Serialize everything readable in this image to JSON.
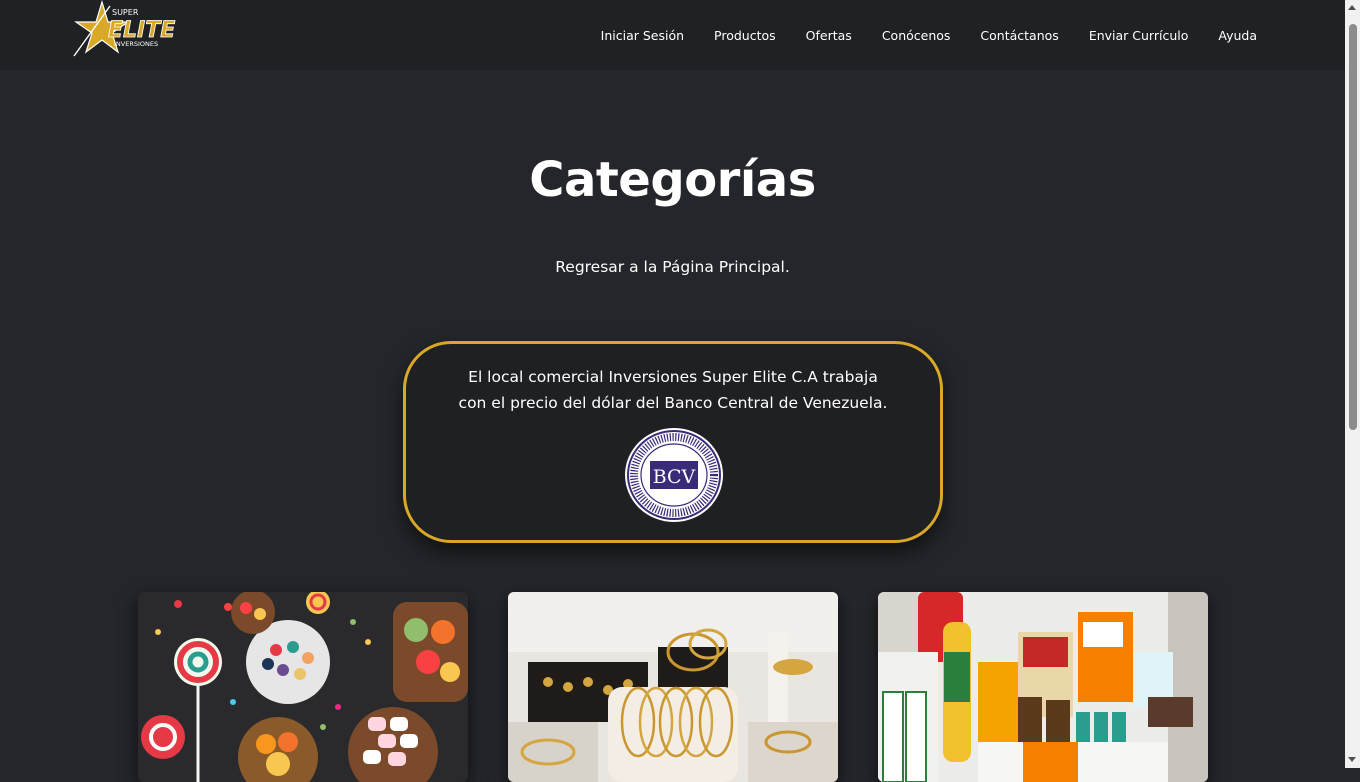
{
  "header": {
    "logo_top": "SUPER",
    "logo_main": "ELITE",
    "logo_sub": "INVERSIONES",
    "nav": [
      "Iniciar Sesión",
      "Productos",
      "Ofertas",
      "Conócenos",
      "Contáctanos",
      "Enviar Currículo",
      "Ayuda"
    ]
  },
  "main": {
    "title": "Categorías",
    "back_link": "Regresar a la Página Principal.",
    "info_line1": "El local comercial Inversiones Super Elite C.A trabaja",
    "info_line2": "con el precio del dólar del Banco Central de Venezuela.",
    "bcv_label": "BCV"
  },
  "colors": {
    "background": "#24262b",
    "header": "#1f2124",
    "accent_gold": "#d8a826",
    "bcv_purple": "#3a2a78"
  },
  "cards": [
    {
      "image": "candy-image"
    },
    {
      "image": "jewelry-image"
    },
    {
      "image": "groceries-image"
    }
  ]
}
